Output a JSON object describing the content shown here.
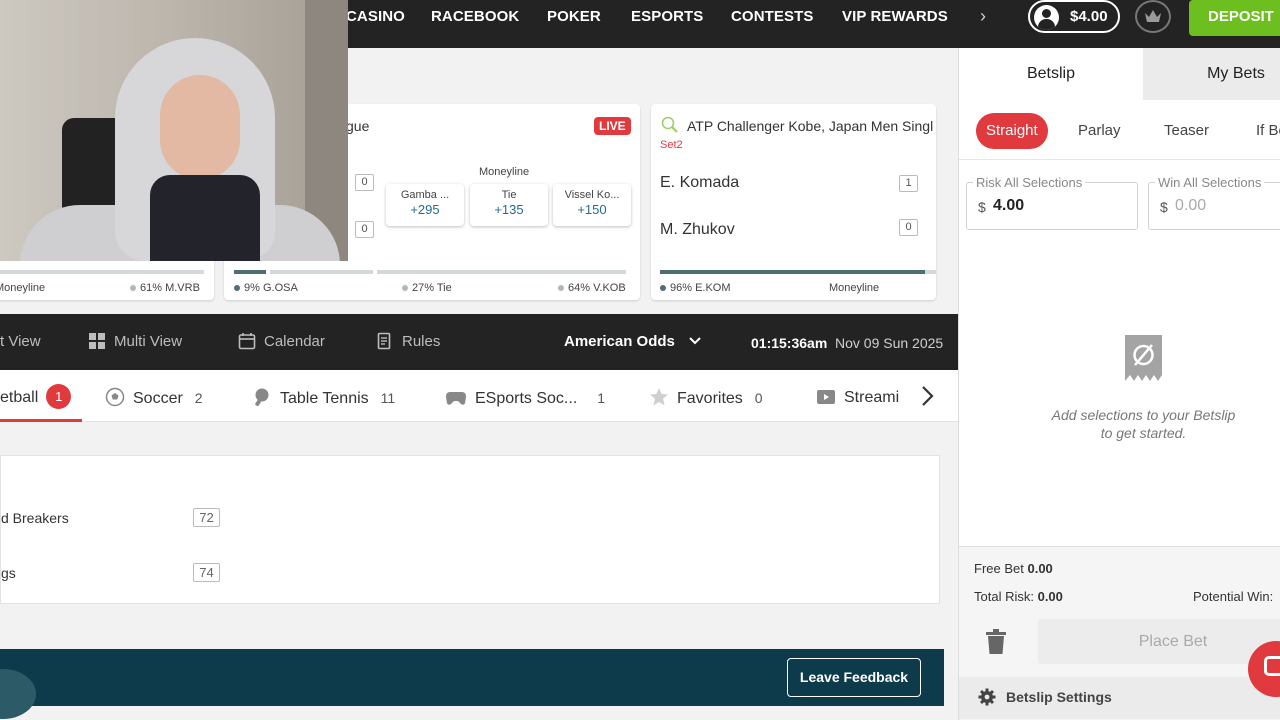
{
  "topnav": {
    "items": [
      "CASINO",
      "RACEBOOK",
      "POKER",
      "ESPORTS",
      "CONTESTS",
      "VIP REWARDS"
    ],
    "balance": "$4.00",
    "deposit_label": "DEPOSIT"
  },
  "cards": {
    "partial": {
      "moneyline_label": "Moneyline",
      "pct_right": "61% M.VRB"
    },
    "soccer": {
      "league": "gue",
      "live": "LIVE",
      "score_home": "0",
      "score_away": "0",
      "market": "Moneyline",
      "odds": [
        {
          "label": "Gamba ...",
          "value": "+295"
        },
        {
          "label": "Tie",
          "value": "+135"
        },
        {
          "label": "Vissel Ko...",
          "value": "+150"
        }
      ],
      "pcts": [
        "9% G.OSA",
        "27% Tie",
        "64% V.KOB"
      ],
      "bar_values": [
        0.09,
        0.27,
        0.64
      ]
    },
    "tennis": {
      "league": "ATP Challenger Kobe, Japan Men Singl",
      "period": "Set2",
      "player1": "E. Komada",
      "player1_score": "1",
      "player2": "M. Zhukov",
      "player2_score": "0",
      "pct": "96% E.KOM",
      "bar_value": 0.96,
      "market": "Moneyline"
    }
  },
  "toolbar": {
    "items": [
      "t View",
      "Multi View",
      "Calendar",
      "Rules"
    ],
    "odds_format": "American Odds",
    "clock": "01:15:36am",
    "date": "Nov 09 Sun 2025"
  },
  "sports": [
    {
      "label": "etball",
      "badge": "1"
    },
    {
      "label": "Soccer",
      "count": "2"
    },
    {
      "label": "Table Tennis",
      "count": "11"
    },
    {
      "label": "ESports Soc...",
      "count": "1"
    },
    {
      "label": "Favorites",
      "count": "0"
    },
    {
      "label": "Streami"
    }
  ],
  "leagues": [
    {
      "name": "d Breakers",
      "count": "72"
    },
    {
      "name": "gs",
      "count": "74"
    }
  ],
  "feedback": {
    "button": "Leave Feedback"
  },
  "betslip": {
    "tabs": [
      "Betslip",
      "My Bets"
    ],
    "bet_types": [
      "Straight",
      "Parlay",
      "Teaser",
      "If Be"
    ],
    "risk_label": "Risk All Selections",
    "risk_currency": "$",
    "risk_value": "4.00",
    "win_label": "Win All Selections",
    "win_currency": "$",
    "win_value": "0.00",
    "empty_line1": "Add selections to your Betslip",
    "empty_line2": "to get started.",
    "free_bet_label": "Free Bet",
    "free_bet_value": "0.00",
    "total_risk_label": "Total Risk:",
    "total_risk_value": "0.00",
    "potential_win_label": "Potential Win:",
    "place_bet": "Place Bet",
    "settings": "Betslip Settings"
  },
  "colors": {
    "accent_red": "#e03a3e",
    "deposit_green": "#6dbe1f",
    "dark_bar": "#232323",
    "banner": "#0e3b4c",
    "odds_blue": "#1f6f8b"
  }
}
